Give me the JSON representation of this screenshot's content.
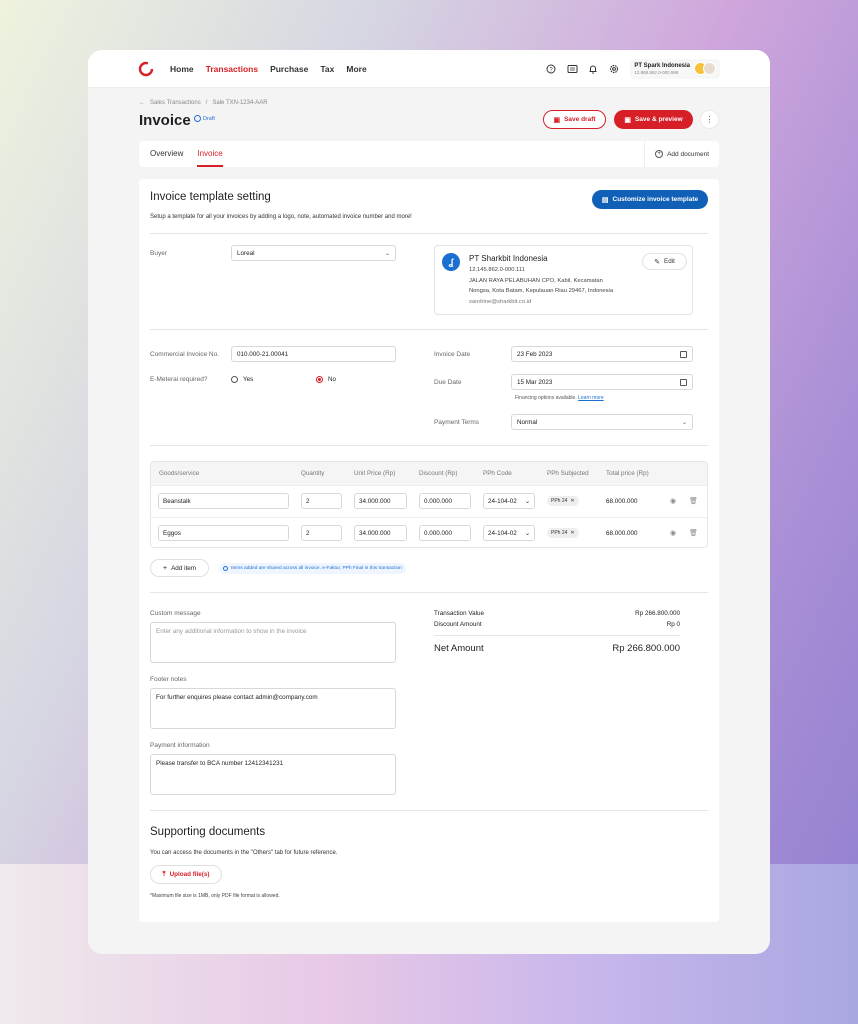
{
  "nav": {
    "items": [
      {
        "label": "Home",
        "active": false
      },
      {
        "label": "Transactions",
        "active": true
      },
      {
        "label": "Purchase",
        "active": false
      },
      {
        "label": "Tax",
        "active": false
      },
      {
        "label": "More",
        "active": false
      }
    ],
    "icons": [
      "help-icon",
      "news-icon",
      "bell-icon",
      "gear-icon"
    ],
    "company_name": "PT Spark Indonesia",
    "company_npwp": "12.868.862.0-000.999"
  },
  "breadcrumb": [
    "Sales Transactions",
    "/",
    "Sale TXN-1234-AAR"
  ],
  "header": {
    "title": "Invoice",
    "badge": "Draft",
    "save_draft": "Save draft",
    "save_preview": "Save & preview"
  },
  "tabs": {
    "items": [
      {
        "label": "Overview",
        "active": false
      },
      {
        "label": "Invoice",
        "active": true
      }
    ],
    "add_document": "Add document"
  },
  "template": {
    "title": "Invoice template setting",
    "subtitle": "Setup a template for all your invoices by adding a logo, note, automated invoice number and more!",
    "customize_button": "Customize invoice template"
  },
  "buyer": {
    "label": "Buyer",
    "value": "Loreal"
  },
  "vendor": {
    "name": "PT Sharkbit Indonesia",
    "npwp": "12.145.862.0-000.111",
    "address1": "JALAN RAYA PELABUHAN CPO, Kabil, Kecamatan",
    "address2": "Nongsa, Kota Batam, Kepulauan Riau 29467, Indonesia",
    "email": "sandrine@sharkbit.co.id",
    "edit": "Edit"
  },
  "form": {
    "commercial_label": "Commercial Invoice No.",
    "commercial_value": "010.000-21.00041",
    "emeterai_label": "E-Meterai required?",
    "yes": "Yes",
    "no": "No",
    "emeterai_selected": "No",
    "invoice_date_label": "Invoice Date",
    "invoice_date": "23 Feb 2023",
    "due_date_label": "Due Date",
    "due_date": "15 Mar 2023",
    "financing_text": "Financing options available.",
    "learn_more": "Learn more",
    "payment_terms_label": "Payment Terms",
    "payment_terms": "Normal"
  },
  "table": {
    "headers": [
      "Goods/service",
      "Quantity",
      "Unit Price (Rp)",
      "Discount (Rp)",
      "PPh Code",
      "PPh Subjected",
      "Total price (Rp)"
    ],
    "rows": [
      {
        "goods": "Beanstalk",
        "qty": "2",
        "unit_price": "34.000.000",
        "discount": "0.000.000",
        "pph_code": "24-104-02",
        "pph": "PPh 24",
        "total": "68.000.000"
      },
      {
        "goods": "Eggos",
        "qty": "2",
        "unit_price": "34.000.000",
        "discount": "0.000.000",
        "pph_code": "24-104-02",
        "pph": "PPh 24",
        "total": "68.000.000"
      }
    ],
    "add_item": "Add item",
    "info": "Items added are shared across all invoice, e-Faktur, PPh Final in this transaction"
  },
  "custom_message": {
    "label": "Custom message",
    "placeholder": "Enter any additional information to show in the invoice"
  },
  "footer_notes": {
    "label": "Footer notes",
    "value": "For further enquires please contact admin@company.com"
  },
  "payment_info": {
    "label": "Payment information",
    "value": "Please transfer to BCA number 12412341231"
  },
  "summary": {
    "transaction_value_label": "Transaction Value",
    "transaction_value": "Rp 266.800.000",
    "discount_label": "Discount Amount",
    "discount": "Rp 0",
    "net_label": "Net Amount",
    "net": "Rp 266.800.000"
  },
  "supporting": {
    "title": "Supporting documents",
    "subtitle": "You can access the documents in the \"Others\" tab for future reference.",
    "upload": "Upload file(s)",
    "note": "*Maximum file size is 1MB, only PDF file format is allowed."
  },
  "colors": {
    "brand_red": "#d61f26",
    "primary_blue": "#1060b8"
  }
}
